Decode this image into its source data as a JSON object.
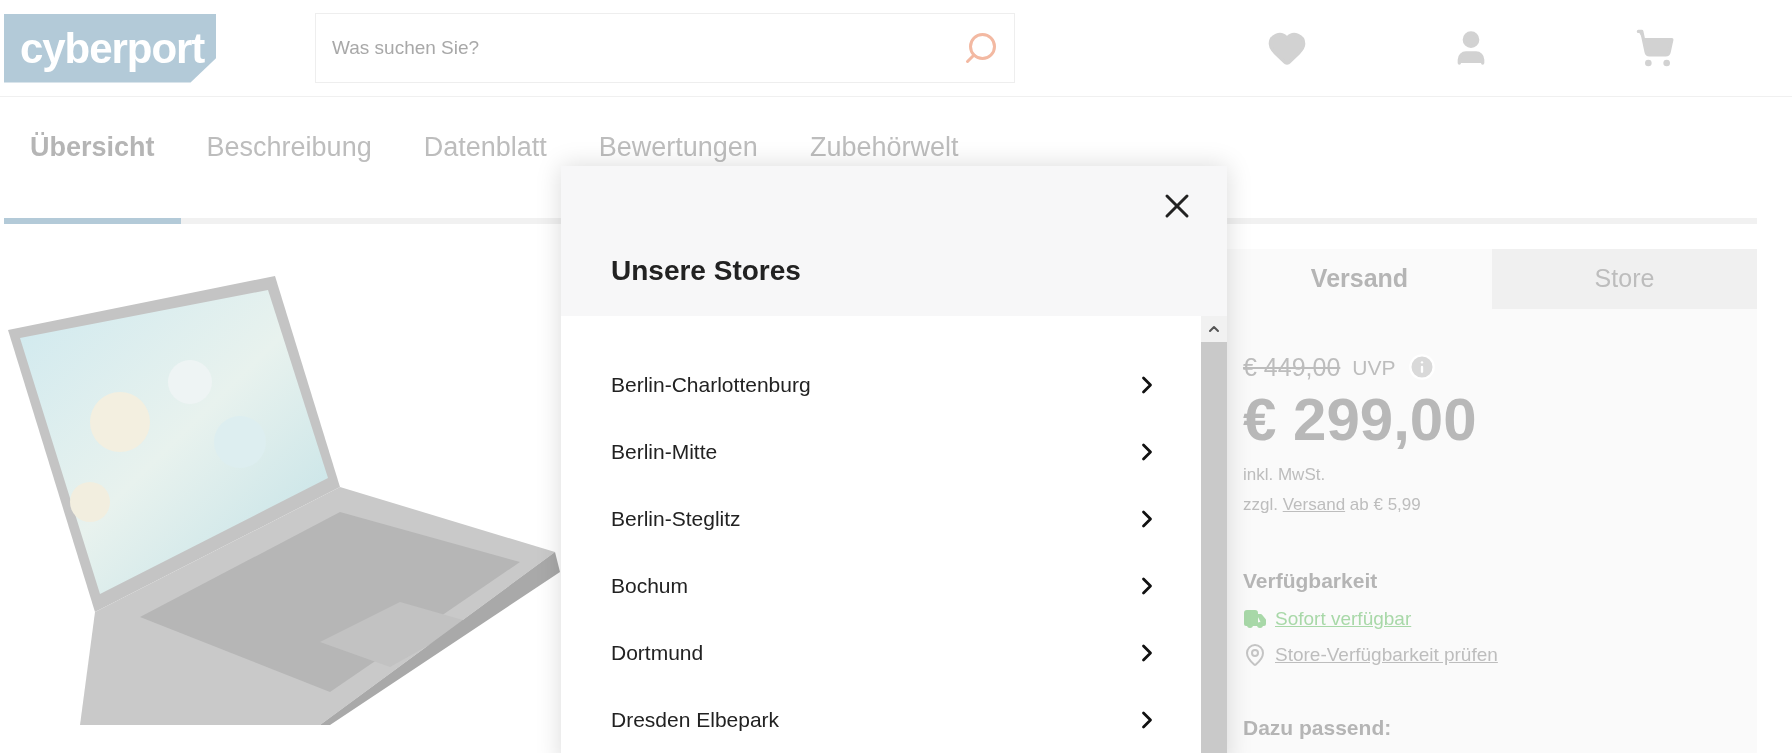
{
  "header": {
    "logo": "cyberport",
    "search": {
      "placeholder": "Was suchen Sie?"
    }
  },
  "tabs": [
    {
      "label": "Übersicht",
      "selected": true
    },
    {
      "label": "Beschreibung",
      "selected": false
    },
    {
      "label": "Datenblatt",
      "selected": false
    },
    {
      "label": "Bewertungen",
      "selected": false
    },
    {
      "label": "Zubehörwelt",
      "selected": false
    }
  ],
  "buy_box": {
    "tabs": [
      {
        "label": "Versand",
        "selected": true
      },
      {
        "label": "Store",
        "selected": false
      }
    ],
    "old_price": "€ 449,00",
    "uvp": "UVP",
    "price": "€ 299,00",
    "tax": "inkl. MwSt.",
    "shipping": {
      "prefix": "zzgl.",
      "link": "Versand",
      "suffix": "ab € 5,99"
    },
    "availability": {
      "heading": "Verfügbarkeit",
      "status": "Sofort verfügbar",
      "store_check": "Store-Verfügbarkeit prüfen"
    },
    "related_heading": "Dazu passend:"
  },
  "modal": {
    "title": "Unsere Stores",
    "stores": [
      "Berlin-Charlottenburg",
      "Berlin-Mitte",
      "Berlin-Steglitz",
      "Bochum",
      "Dortmund",
      "Dresden Elbepark"
    ]
  }
}
